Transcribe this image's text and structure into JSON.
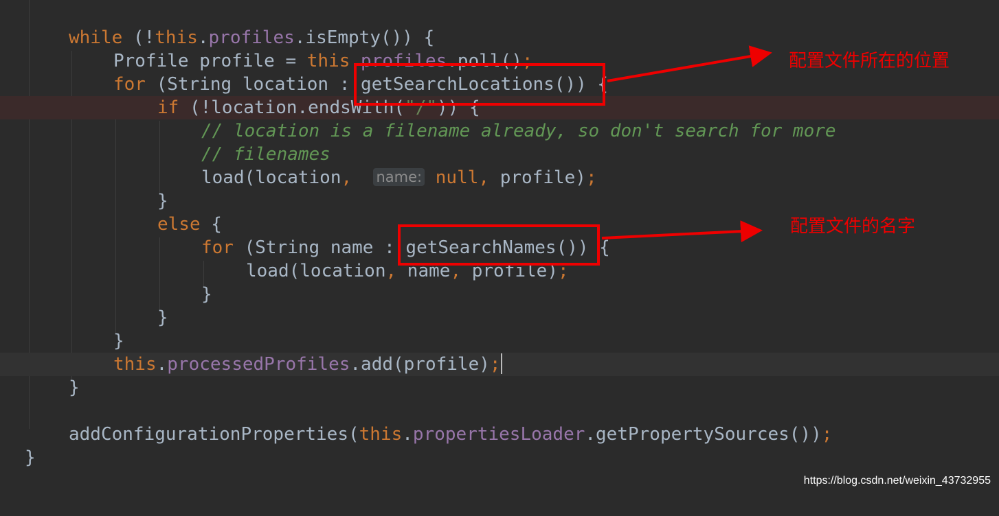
{
  "code": {
    "l1": {
      "kw": "while",
      "open": " (!",
      "this": "this",
      "dot": ".",
      "fld": "profiles",
      "rest": ".isEmpty()) {"
    },
    "l2": {
      "pre": "Profile profile = ",
      "this": "this",
      "dot": ".",
      "fld": "profiles",
      "rest": ".poll()",
      "semi": ";"
    },
    "l3": {
      "kw": "for",
      "rest": " (String location : getSearchLocations()) {"
    },
    "l4": {
      "kw": "if",
      "rest": " (!location.endsWith(",
      "str": "\"/\"",
      "end": ")) {"
    },
    "l5": {
      "comment": "// location is a filename already, so don't search for more"
    },
    "l6": {
      "comment": "// filenames"
    },
    "l7": {
      "pre": "load(location",
      "comma": ",",
      "hint": "name:",
      "null": "null",
      "comma2": ",",
      "post": " profile)",
      "semi": ";"
    },
    "l8": {
      "text": "}"
    },
    "l9": {
      "kw": "else",
      "rest": " {"
    },
    "l10": {
      "kw": "for",
      "rest": " (String name : getSearchNames()) {"
    },
    "l11": {
      "pre": "load(location",
      "c1": ",",
      "mid": " name",
      "c2": ",",
      "post": " profile)",
      "semi": ";"
    },
    "l12": {
      "text": "}"
    },
    "l13": {
      "text": "}"
    },
    "l14": {
      "text": "}"
    },
    "l15": {
      "this": "this",
      "dot": ".",
      "fld": "processedProfiles",
      "rest": ".add(profile)",
      "semi": ";"
    },
    "l16": {
      "text": "}"
    },
    "l17": {
      "pre": "addConfigurationProperties(",
      "this": "this",
      "dot": ".",
      "fld": "propertiesLoader",
      "rest": ".getPropertySources())",
      "semi": ";"
    },
    "l18": {
      "text": "}"
    }
  },
  "annotations": {
    "locations": "配置文件所在的位置",
    "names": "配置文件的名字"
  },
  "watermark": "https://blog.csdn.net/weixin_43732955",
  "colors": {
    "background": "#2b2b2b",
    "keyword": "#cc7832",
    "field": "#9876aa",
    "comment": "#629755",
    "text": "#a9b7c6",
    "annotation_red": "#ee0000"
  }
}
